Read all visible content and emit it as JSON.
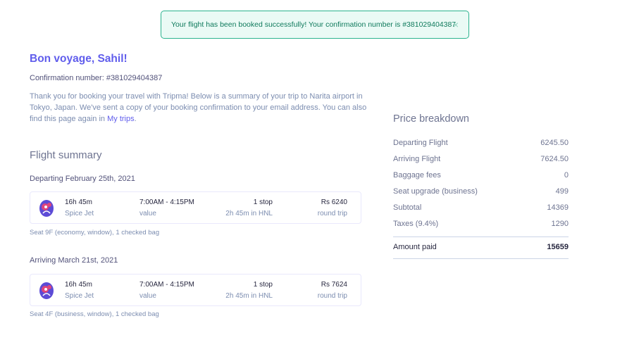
{
  "toast": {
    "message": "Your flight has been booked successfully! Your confirmation number is #381029404387",
    "close_icon": "×"
  },
  "greeting": "Bon voyage, Sahil!",
  "confirmation_line": "Confirmation number: #381029404387",
  "intro": {
    "text": "Thank you for booking your travel with Tripma! Below is a summary of your trip to Narita airport in Tokyo, Japan. We've sent a copy of your booking confirmation to your email address. You can also find this page again in",
    "link": "My trips",
    "end": "."
  },
  "flight_summary": {
    "title": "Flight summary",
    "departing": {
      "heading": "Departing February 25th, 2021",
      "duration": "16h 45m",
      "airline": "Spice Jet",
      "times": "7:00AM - 4:15PM",
      "times_sub": "value",
      "stops": "1 stop",
      "layover": "2h 45m in HNL",
      "price": "Rs 6240",
      "trip_type": "round trip",
      "seat_note": "Seat 9F (economy, window), 1 checked bag"
    },
    "arriving": {
      "heading": "Arriving March 21st, 2021",
      "duration": "16h 45m",
      "airline": "Spice Jet",
      "times": "7:00AM - 4:15PM",
      "times_sub": "value",
      "stops": "1 stop",
      "layover": "2h 45m in HNL",
      "price": "Rs 7624",
      "trip_type": "round trip",
      "seat_note": "Seat 4F (business, window), 1 checked bag"
    }
  },
  "price_breakdown": {
    "title": "Price breakdown",
    "rows": [
      {
        "label": "Departing Flight",
        "value": "6245.50"
      },
      {
        "label": "Arriving Flight",
        "value": "7624.50"
      },
      {
        "label": "Baggage fees",
        "value": "0"
      },
      {
        "label": "Seat upgrade (business)",
        "value": "499"
      },
      {
        "label": "Subtotal",
        "value": "14369"
      },
      {
        "label": "Taxes (9.4%)",
        "value": "1290"
      }
    ],
    "total_label": "Amount paid",
    "total_value": "15659"
  },
  "colors": {
    "accent": "#605dec",
    "success": "#2bb38f",
    "text": "#6e7491"
  },
  "icons": {
    "airline_logo": "airline-logo-icon"
  }
}
